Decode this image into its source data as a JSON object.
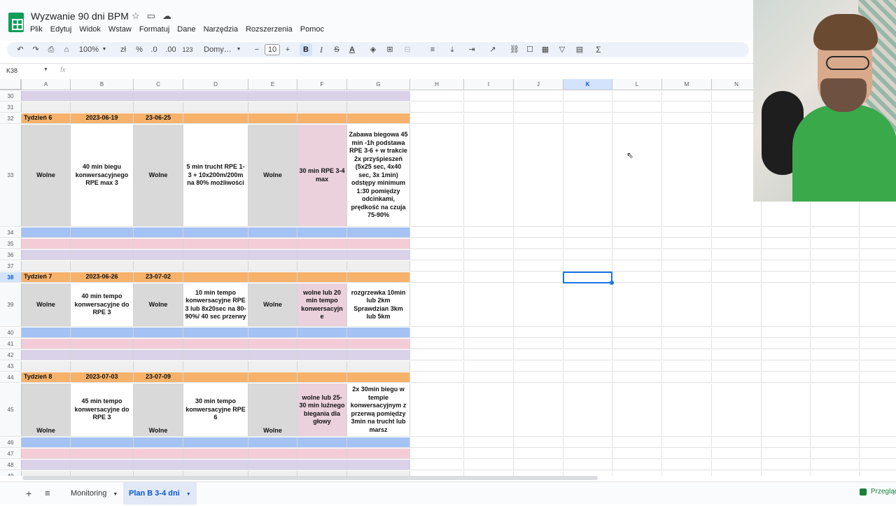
{
  "doc": {
    "title": "Wyzwanie 90 dni BPM"
  },
  "menu": [
    "Plik",
    "Edytuj",
    "Widok",
    "Wstaw",
    "Formatuj",
    "Dane",
    "Narzędzia",
    "Rozszerzenia",
    "Pomoc"
  ],
  "toolbar": {
    "zoom": "100%",
    "currency": "zł",
    "percent": "%",
    "dec_less": ".0",
    "dec_more": ".00",
    "num_format": "123",
    "font": "Domy…",
    "font_size": "10",
    "bold": "B",
    "italic": "I",
    "sum": "Σ"
  },
  "formula_bar": {
    "cell_ref": "K38",
    "fx": "fx"
  },
  "columns": [
    "A",
    "B",
    "C",
    "D",
    "E",
    "F",
    "G",
    "H",
    "I",
    "J",
    "K",
    "L",
    "M",
    "N"
  ],
  "selected_column": "K",
  "selected_row": "38",
  "colors": {
    "week_header": "#f6b26b",
    "blue_row": "#a4c2f4",
    "pink_row": "#f4ccd8",
    "lavender_row": "#d9d2e9",
    "light_row": "#efefef",
    "rest_cell": "#d9d9d9",
    "pink_cell": "#ead1dc",
    "white_cell": "#ffffff",
    "selection": "#1a73e8"
  },
  "rows": [
    {
      "num": "30",
      "type": "lavender"
    },
    {
      "num": "31",
      "type": "light"
    },
    {
      "num": "32",
      "type": "week",
      "cells": [
        "Tydzień 6",
        "2023-06-19",
        "23-06-25",
        "",
        "",
        "",
        ""
      ]
    },
    {
      "num": "33",
      "type": "content",
      "cells": [
        "Wolne",
        "40 min biegu konwersacyjnego RPE max 3",
        "Wolne",
        "5 min trucht RPE 1-3 + 10x200m/200m na 80% możliwości",
        "Wolne",
        "30 min RPE 3-4 max",
        "Zabawa biegowa 45 min -1h podstawa RPE 3-6 + w trakcie 2x przyśpieszeń (5x25 sec, 4x40 sec, 3x 1min) odstępy minimum 1:30 pomiędzy odcinkami, prędkość na czuja 75-90%"
      ]
    },
    {
      "num": "34",
      "type": "blue"
    },
    {
      "num": "35",
      "type": "pink"
    },
    {
      "num": "36",
      "type": "lavender"
    },
    {
      "num": "37",
      "type": "light"
    },
    {
      "num": "38",
      "type": "week",
      "cells": [
        "Tydzień 7",
        "2023-06-26",
        "23-07-02",
        "",
        "",
        "",
        ""
      ]
    },
    {
      "num": "39",
      "type": "content",
      "cells": [
        "Wolne",
        "40 min tempo konwersacyjne do RPE 3",
        "Wolne",
        "10 min tempo konwersacyjne RPE 3 lub 8x20sec na 80-90%/ 40 sec przerwy",
        "Wolne",
        "wolne lub 20 min tempo konwersacyjn e",
        "rozgrzewka 10min lub 2km Sprawdzian 3km lub 5km"
      ]
    },
    {
      "num": "40",
      "type": "blue"
    },
    {
      "num": "41",
      "type": "pink"
    },
    {
      "num": "42",
      "type": "lavender"
    },
    {
      "num": "43",
      "type": "light"
    },
    {
      "num": "44",
      "type": "week",
      "cells": [
        "Tydzień 8",
        "2023-07-03",
        "23-07-09",
        "",
        "",
        "",
        ""
      ]
    },
    {
      "num": "45",
      "type": "content",
      "cells": [
        "Wolne",
        "45 min tempo konwersacyjne do RPE 3",
        "Wolne",
        "30 min tempo konwersacyjne RPE 6",
        "Wolne",
        "wolne lub 25-30 min luźnego biegania dla głowy",
        "2x 30min biegu w tempie konwersacyjnym z przerwą pomiędzy 3min na trucht lub marsz"
      ]
    },
    {
      "num": "46",
      "type": "blue"
    },
    {
      "num": "47",
      "type": "pink"
    },
    {
      "num": "48",
      "type": "lavender"
    },
    {
      "num": "49",
      "type": "light"
    }
  ],
  "sheets": [
    {
      "label": "Monitoring",
      "active": false
    },
    {
      "label": "Plan B 3-4 dni",
      "active": true
    }
  ],
  "explore_label": "Przegląd"
}
